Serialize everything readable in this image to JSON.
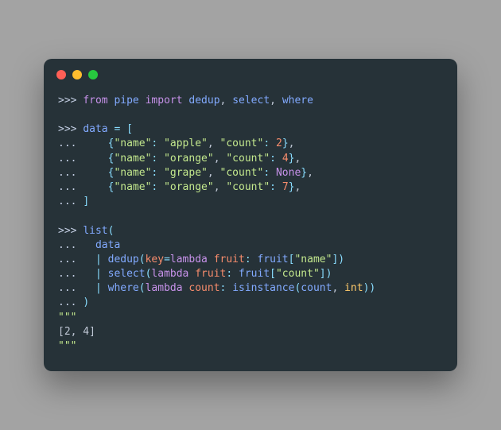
{
  "window": {
    "traffic_lights": [
      "red",
      "yellow",
      "green"
    ]
  },
  "prompts": {
    "primary": ">>>",
    "continuation": "..."
  },
  "tokens": {
    "from": "from",
    "import": "import",
    "pipe": "pipe",
    "dedup": "dedup",
    "select": "select",
    "where": "where",
    "data": "data",
    "eq": "=",
    "lbrack": "[",
    "rbrack": "]",
    "lbrace": "{",
    "rbrace": "}",
    "lparen": "(",
    "rparen": ")",
    "comma": ",",
    "colon": ":",
    "name_key": "\"name\"",
    "count_key": "\"count\"",
    "apple": "\"apple\"",
    "orange": "\"orange\"",
    "grape": "\"grape\"",
    "n2": "2",
    "n4": "4",
    "n7": "7",
    "none": "None",
    "list": "list",
    "pipe_op": "|",
    "key_kw": "key",
    "lambda": "lambda",
    "fruit": "fruit",
    "count": "count",
    "isinstance": "isinstance",
    "int": "int",
    "result": "[2, 4]",
    "triple_quote": "\"\"\""
  }
}
